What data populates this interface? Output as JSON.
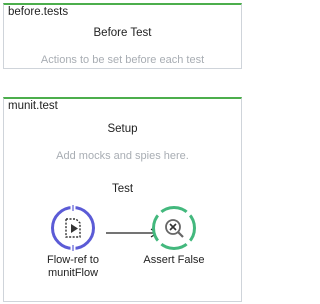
{
  "before": {
    "title": "before.tests",
    "section": "Before Test",
    "hint": "Actions to be set before each test"
  },
  "test": {
    "title": "munit.test",
    "setup_label": "Setup",
    "setup_hint": "Add mocks and spies here.",
    "test_label": "Test",
    "nodes": [
      {
        "label_line1": "Flow-ref to",
        "label_line2": "munitFlow",
        "icon": "flow-ref-icon",
        "color": "#5b5bd6"
      },
      {
        "label_line1": "Assert False",
        "label_line2": "",
        "icon": "assert-false-icon",
        "color": "#43b87d"
      }
    ]
  },
  "colors": {
    "panel_accent": "#4cae4c",
    "hint_text": "#a8adb3"
  }
}
